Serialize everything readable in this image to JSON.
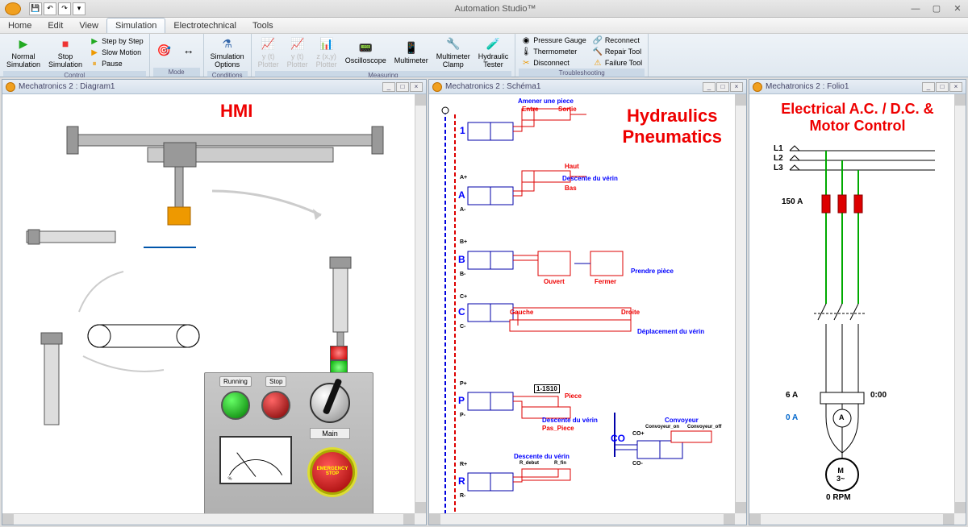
{
  "app": {
    "title": "Automation Studio™"
  },
  "tabs": [
    "Home",
    "Edit",
    "View",
    "Simulation",
    "Electrotechnical",
    "Tools"
  ],
  "active_tab": 3,
  "ribbon": {
    "control": {
      "label": "Control",
      "normal_sim": "Normal\nSimulation",
      "stop_sim": "Stop\nSimulation",
      "step": "Step by Step",
      "slow": "Slow Motion",
      "pause": "Pause"
    },
    "mode": {
      "label": "Mode"
    },
    "conditions": {
      "label": "Conditions",
      "sim_options": "Simulation\nOptions"
    },
    "measuring": {
      "label": "Measuring",
      "y_plotter": "y (t)\nPlotter",
      "yalt": "y (t)\nPlotter",
      "z_plotter": "z (x,y)\nPlotter",
      "osc": "Oscilloscope",
      "multi": "Multimeter",
      "clamp": "Multimeter\nClamp",
      "hyd": "Hydraulic\nTester"
    },
    "troubleshooting": {
      "label": "Troubleshooting",
      "pressure": "Pressure Gauge",
      "thermo": "Thermometer",
      "disconnect": "Disconnect",
      "reconnect": "Reconnect",
      "repair": "Repair Tool",
      "failure": "Failure Tool"
    }
  },
  "panes": {
    "p1": {
      "title": "Mechatronics 2 : Diagram1",
      "heading": "HMI"
    },
    "p2": {
      "title": "Mechatronics 2 : Schéma1",
      "heading": "Hydraulics\nPneumatics"
    },
    "p3": {
      "title": "Mechatronics 2 : Folio1",
      "heading": "Electrical A.C. / D.C. &\nMotor Control"
    }
  },
  "hmi": {
    "running": "Running",
    "stop": "Stop",
    "main": "Main",
    "estop1": "EMERGENCY",
    "estop2": "STOP"
  },
  "hydraulics": {
    "amener": "Amener une piece",
    "entre": "Entre",
    "sortie": "Sortie",
    "haut": "Haut",
    "bas": "Bas",
    "descente": "Descente du vérin",
    "ouvert": "Ouvert",
    "fermer": "Fermer",
    "prendre": "Prendre pièce",
    "gauche": "Gauche",
    "droite": "Droite",
    "deplacement": "Déplacement du vérin",
    "piece": "Piece",
    "pas_piece": "Pas_Piece",
    "sensor": "1-1S10",
    "r_debut": "R_debut",
    "r_fin": "R_fin",
    "conv": "Convoyeur",
    "conv_on": "Convoyeur_on",
    "conv_off": "Convoyeur_off",
    "v1": "1",
    "va": "A",
    "vb": "B",
    "vc": "C",
    "vp": "P",
    "vr": "R",
    "vco": "CO",
    "ap": "A+",
    "am": "A-",
    "bp": "B+",
    "bm": "B-",
    "cp": "C+",
    "cm": "C-",
    "pp": "P+",
    "pm": "P-",
    "rp": "R+",
    "rm": "R-",
    "cop": "CO+",
    "com": "CO-"
  },
  "electrical": {
    "l1": "L1",
    "l2": "L2",
    "l3": "L3",
    "fuse": "150 A",
    "breaker": "6 A",
    "timer": "0:00",
    "amps": "0 A",
    "rpm": "0 RPM",
    "motor": "M\n3~",
    "ammeter": "A"
  }
}
